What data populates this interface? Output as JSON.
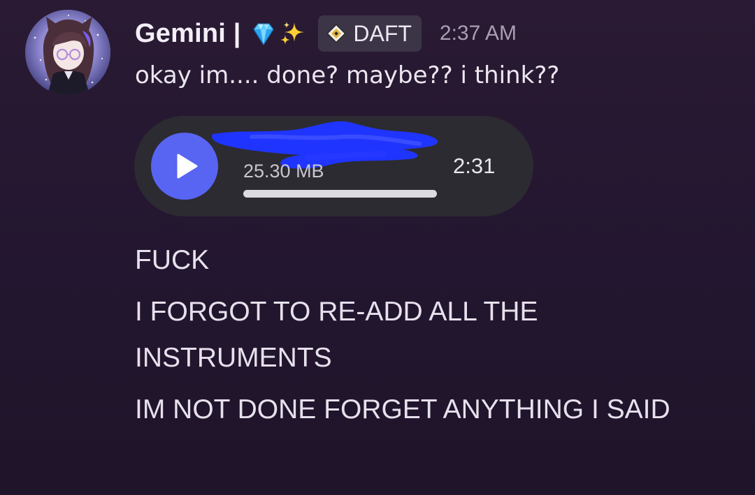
{
  "message": {
    "author": {
      "name": "Gemini | ",
      "emojis": [
        "gem-emoji",
        "sparkles-emoji"
      ],
      "tag": {
        "icon": "daft-badge-icon",
        "label": "DAFT"
      }
    },
    "timestamp": "2:37 AM",
    "content": "okay im.... done? maybe?? i think??",
    "attachment": {
      "type": "audio",
      "file_name_redacted": true,
      "file_size": "25.30 MB",
      "duration": "2:31",
      "progress": 0,
      "colors": {
        "play_button": "#5865f2",
        "redaction": "#1f35ff"
      }
    }
  },
  "followups": [
    "FUCK",
    "I FORGOT TO RE-ADD ALL THE INSTRUMENTS",
    "IM NOT DONE FORGET ANYTHING I SAID"
  ]
}
